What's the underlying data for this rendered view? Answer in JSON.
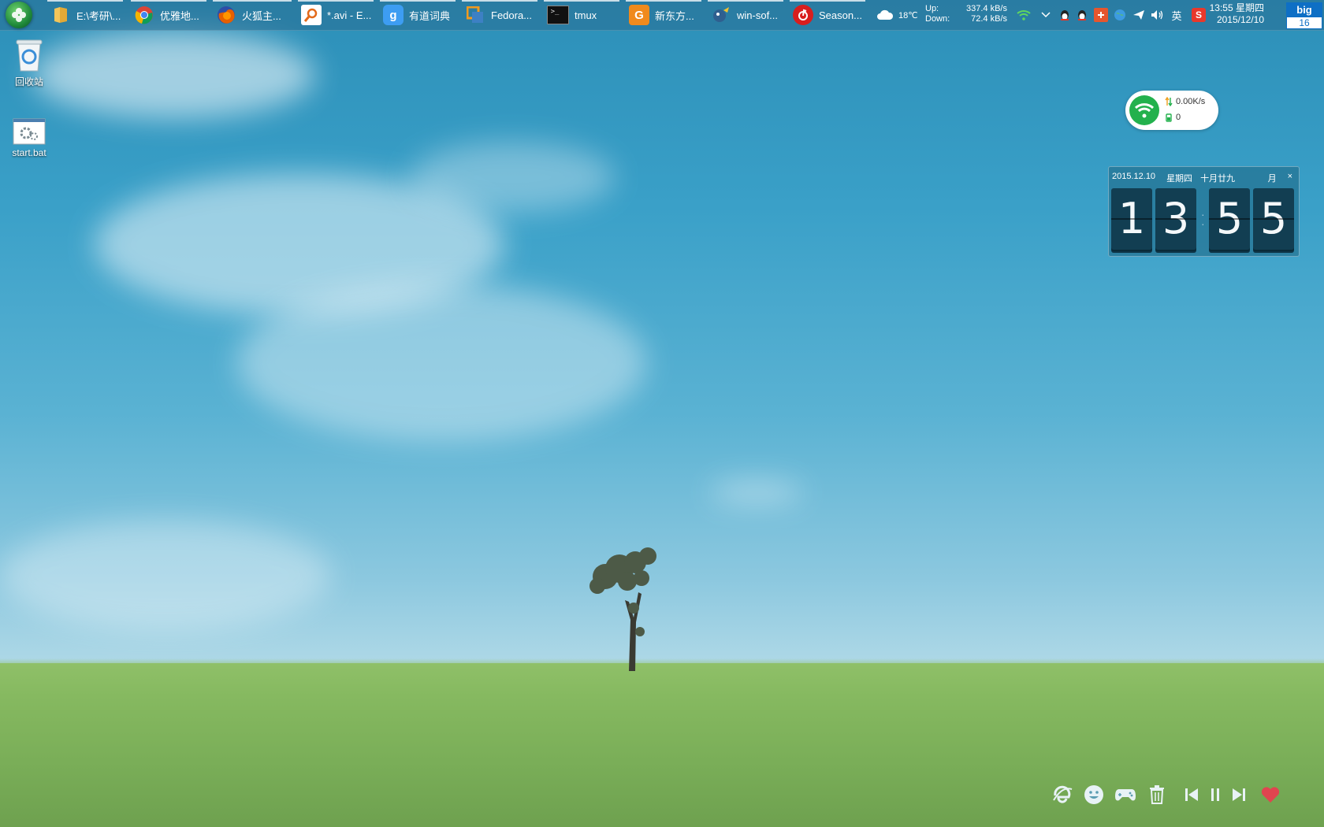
{
  "taskbar": {
    "tasks": [
      {
        "label": "E:\\考研\\...",
        "icon": "folder-icon"
      },
      {
        "label": "优雅地...",
        "icon": "chrome-icon"
      },
      {
        "label": "火狐主...",
        "icon": "firefox-icon"
      },
      {
        "label": "*.avi - E...",
        "icon": "everything-search-icon"
      },
      {
        "label": "有道词典",
        "icon": "youdao-dict-icon"
      },
      {
        "label": "Fedora...",
        "icon": "vmware-icon"
      },
      {
        "label": "tmux",
        "icon": "terminal-icon"
      },
      {
        "label": "新东方...",
        "icon": "pdf-reader-icon"
      },
      {
        "label": "win-sof...",
        "icon": "bird-app-icon"
      },
      {
        "label": "Season...",
        "icon": "netease-music-icon"
      }
    ],
    "weather": {
      "temp": "18℃",
      "icon": "cloud-icon"
    },
    "netspeed": {
      "up_label": "Up:",
      "up_value": "337.4 kB/s",
      "down_label": "Down:",
      "down_value": "72.4 kB/s"
    },
    "tray": {
      "ime_label": "英"
    },
    "clock": {
      "time": "13:55",
      "weekday": "星期四",
      "date": "2015/12/10"
    },
    "badge": {
      "top": "big",
      "bottom": "16"
    }
  },
  "desktop": {
    "icons": [
      {
        "label": "回收站",
        "icon": "recycle-bin-icon"
      },
      {
        "label": "start.bat",
        "icon": "batch-file-icon"
      }
    ]
  },
  "wifi_widget": {
    "speed": "0.00K/s",
    "count": "0"
  },
  "flip_clock": {
    "date": "2015.12.10",
    "weekday": "星期四",
    "lunar": "十月廿九",
    "month_btn": "月",
    "close": "×",
    "digits": [
      "1",
      "3",
      "5",
      "5"
    ]
  },
  "colors": {
    "accent": "#0e6fc5",
    "wifi_green": "#23b14d",
    "heart": "#e0454f"
  }
}
